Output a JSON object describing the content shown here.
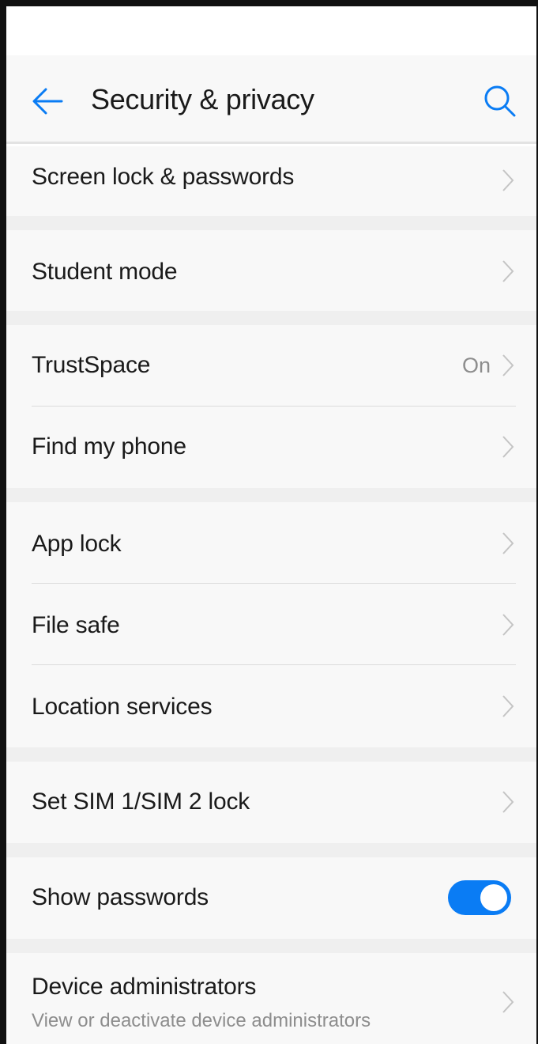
{
  "header": {
    "title": "Security & privacy",
    "accent_color": "#0a7cf4",
    "back_icon": "arrow-left-icon",
    "search_icon": "search-icon"
  },
  "items": [
    {
      "label": "Screen lock & passwords"
    },
    {
      "label": "Student mode"
    },
    {
      "label": "TrustSpace",
      "value": "On"
    },
    {
      "label": "Find my phone"
    },
    {
      "label": "App lock"
    },
    {
      "label": "File safe"
    },
    {
      "label": "Location services"
    },
    {
      "label": "Set SIM 1/SIM 2 lock"
    },
    {
      "label": "Show passwords",
      "toggle": true
    },
    {
      "label": "Device administrators",
      "subtitle": "View or deactivate device administrators"
    }
  ]
}
